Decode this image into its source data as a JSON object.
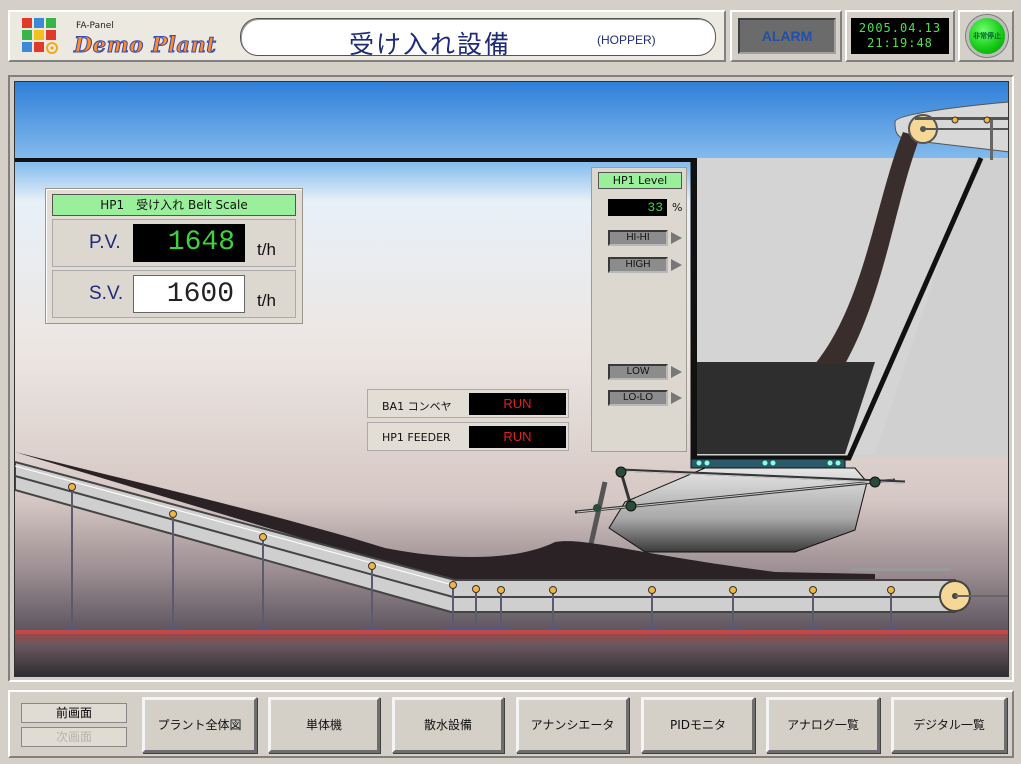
{
  "header": {
    "logo_sub": "FA-Panel",
    "logo_main": "Demo Plant",
    "title": "受け入れ設備",
    "title_en": "(HOPPER)",
    "alarm_label": "ALARM",
    "date": "2005.04.13",
    "time": "21:19:48",
    "estop_label": "非常停止"
  },
  "belt_scale": {
    "title": "HP1　受け入れ Belt Scale",
    "pv_label": "P.V.",
    "pv_value": "1648",
    "pv_unit": "t/h",
    "sv_label": "S.V.",
    "sv_value": "1600",
    "sv_unit": "t/h"
  },
  "level": {
    "title": "HP1 Level",
    "value": "33",
    "unit": "%",
    "hihi": "HI-HI",
    "high": "HIGH",
    "low": "LOW",
    "lolo": "LO-LO"
  },
  "status": {
    "conveyor_label": "BA1 コンベヤ",
    "conveyor_value": "RUN",
    "feeder_label": "HP1 FEEDER",
    "feeder_value": "RUN"
  },
  "footer": {
    "prev": "前画面",
    "next": "次画面",
    "buttons": [
      "プラント全体図",
      "単体機",
      "散水設備",
      "アナンシエータ",
      "PIDモニタ",
      "アナログ一覧",
      "デジタル一覧"
    ]
  },
  "colors": {
    "accent_green": "#9af09a",
    "run_red": "#e02020",
    "digit_green": "#40d040"
  }
}
